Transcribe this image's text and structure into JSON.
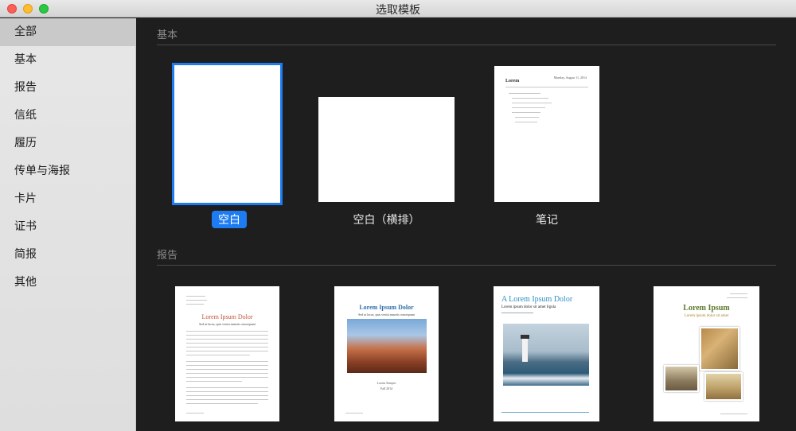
{
  "window": {
    "title": "选取模板"
  },
  "sidebar": {
    "items": [
      {
        "label": "全部",
        "selected": true
      },
      {
        "label": "基本",
        "selected": false
      },
      {
        "label": "报告",
        "selected": false
      },
      {
        "label": "信纸",
        "selected": false
      },
      {
        "label": "履历",
        "selected": false
      },
      {
        "label": "传单与海报",
        "selected": false
      },
      {
        "label": "卡片",
        "selected": false
      },
      {
        "label": "证书",
        "selected": false
      },
      {
        "label": "简报",
        "selected": false
      },
      {
        "label": "其他",
        "selected": false
      }
    ]
  },
  "sections": {
    "basic": {
      "header": "基本",
      "templates": [
        {
          "label": "空白",
          "selected": true
        },
        {
          "label": "空白（横排）",
          "selected": false
        },
        {
          "label": "笔记",
          "selected": false
        }
      ]
    },
    "reports": {
      "header": "报告",
      "templates": [
        {
          "title": "Lorem Ipsum Dolor",
          "subtitle": "Sed ut lacus, quis vestiu maurits consequunt",
          "title_color": "#c4553c"
        },
        {
          "title": "Lorem Ipsum Dolor",
          "subtitle": "Sed ut lacus, quis vestiu maurits consequunt",
          "byline": "Lorem Semper",
          "date": "Fall 2014",
          "title_color": "#2f6fa8"
        },
        {
          "title": "A Lorem Ipsum Dolor",
          "subtitle": "Lorem ipsum dolor sit amet ligula",
          "title_color": "#2f8fc4"
        },
        {
          "title": "Lorem Ipsum",
          "subtitle": "Lorem ipsum dolor sit amet",
          "title_color": "#5a7a2a"
        }
      ]
    }
  },
  "notes_thumb": {
    "title": "Lorem",
    "date": "Monday, August 11, 2014"
  },
  "colors": {
    "accent": "#1e7cf2",
    "background": "#1e1e1e",
    "sidebar": "#e3e3e3"
  }
}
